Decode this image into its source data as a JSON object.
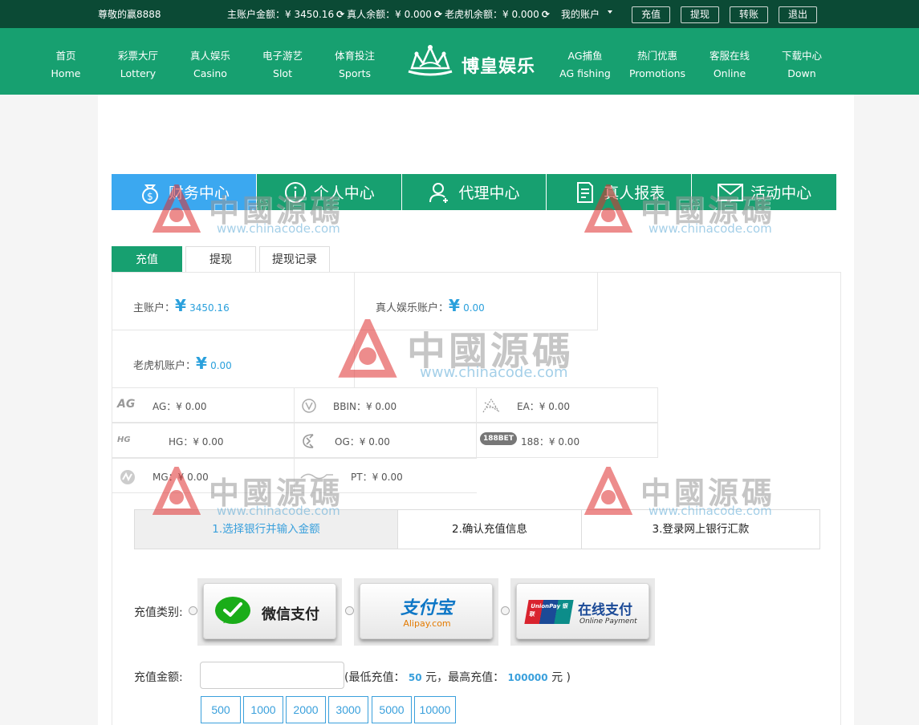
{
  "topbar": {
    "greeting": "尊敬的赢8888",
    "balances": [
      "主账户金额：¥ 3450.16",
      "真人余额：¥ 0.000",
      "老虎机余额：¥ 0.000"
    ],
    "my_account": "我的账户",
    "buttons": [
      "充值",
      "提现",
      "转账",
      "退出"
    ]
  },
  "nav": {
    "left": [
      {
        "cn": "首页",
        "en": "Home"
      },
      {
        "cn": "彩票大厅",
        "en": "Lottery"
      },
      {
        "cn": "真人娱乐",
        "en": "Casino"
      },
      {
        "cn": "电子游艺",
        "en": "Slot"
      },
      {
        "cn": "体育投注",
        "en": "Sports"
      }
    ],
    "logo_text": "博皇娱乐",
    "right": [
      {
        "cn": "AG捕鱼",
        "en": "AG fishing"
      },
      {
        "cn": "热门优惠",
        "en": "Promotions"
      },
      {
        "cn": "客服在线",
        "en": "Online"
      },
      {
        "cn": "下载中心",
        "en": "Down"
      }
    ]
  },
  "main_tabs": [
    "财务中心",
    "个人中心",
    "代理中心",
    "真人报表",
    "活动中心"
  ],
  "sub_tabs": [
    "充值",
    "提现",
    "提现记录"
  ],
  "accounts": {
    "main_label": "主账户：",
    "main_value": "3450.16",
    "live_label": "真人娱乐账户：",
    "live_value": "0.00",
    "slot_label": "老虎机账户：",
    "slot_value": "0.00",
    "yen": "¥"
  },
  "games": [
    {
      "logo": "AG",
      "text": "AG：¥ 0.00"
    },
    {
      "logo": "",
      "text": "BBIN：¥ 0.00"
    },
    {
      "logo": "",
      "text": "EA：¥ 0.00"
    },
    {
      "logo": "HG",
      "text": "HG：¥ 0.00"
    },
    {
      "logo": "",
      "text": "OG：¥ 0.00"
    },
    {
      "logo": "188BET",
      "text": "188：¥ 0.00"
    },
    {
      "logo": "",
      "text": "MG：¥ 0.00"
    },
    {
      "logo": "",
      "text": "PT：¥ 0.00"
    }
  ],
  "steps": [
    "1.选择银行并输入金额",
    "2.确认充值信息",
    "3.登录网上银行汇款"
  ],
  "recharge": {
    "type_label": "充值类别:",
    "options": [
      {
        "name": "微信支付"
      },
      {
        "name": "支付宝",
        "sub": "Alipay.com"
      },
      {
        "name": "在线支付",
        "sub": "Online Payment",
        "badge": "UnionPay 银联"
      }
    ],
    "amount_label": "充值金额:",
    "amount_value": "",
    "range_prefix": "(最低充值：",
    "min": "50",
    "range_mid": "元，最高充值：",
    "max": "100000",
    "range_suffix": "元 )",
    "quick_amounts": [
      "500",
      "1000",
      "2000",
      "3000",
      "5000",
      "10000"
    ]
  },
  "watermark": {
    "cn": "中國源碼",
    "url": "www.chinacode.com"
  },
  "colors": {
    "topbar": "#0b4a35",
    "nav": "#17a070",
    "active_tab": "#3ba8f0",
    "accent": "#3aa0dc"
  }
}
